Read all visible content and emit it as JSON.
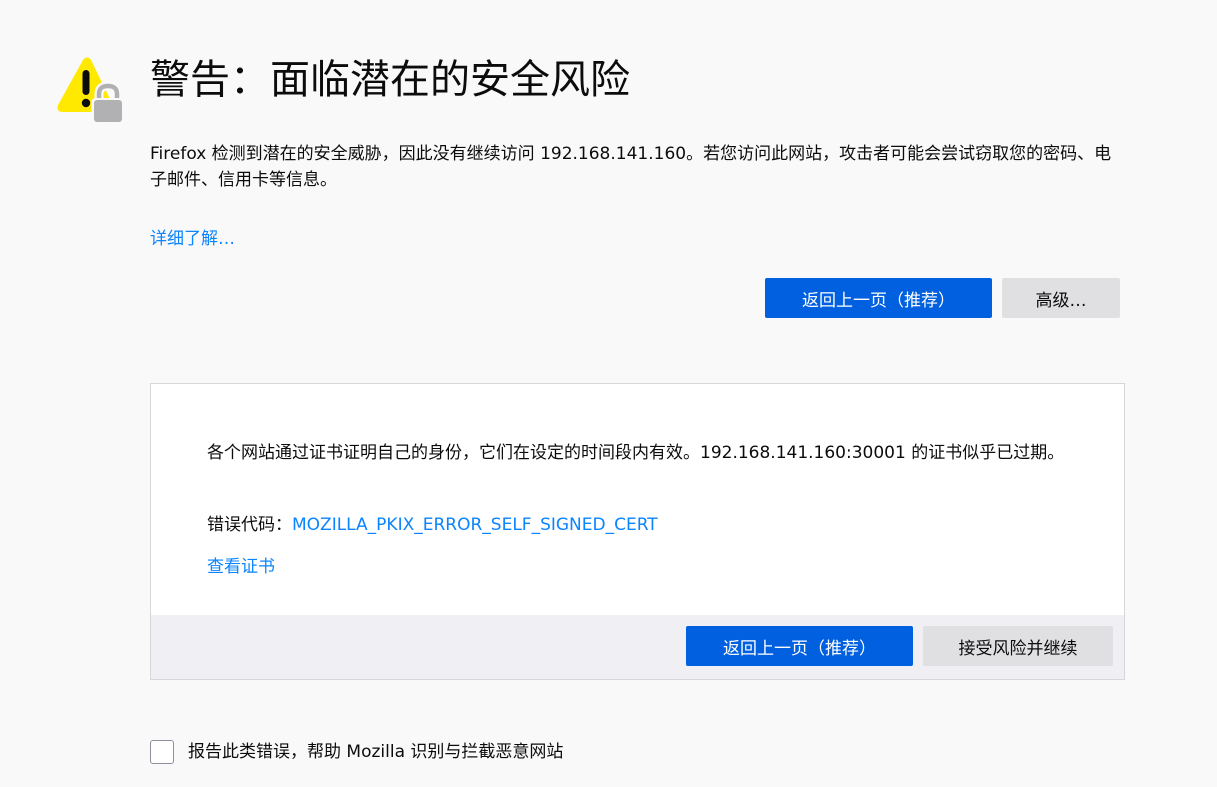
{
  "header": {
    "icon": "warning-lock-icon",
    "title": "警告：面临潜在的安全风险",
    "description": "Firefox 检测到潜在的安全威胁，因此没有继续访问 192.168.141.160。若您访问此网站，攻击者可能会尝试窃取您的密码、电子邮件、信用卡等信息。",
    "learn_more": "详细了解…"
  },
  "actions": {
    "go_back_label": "返回上一页（推荐）",
    "advanced_label": "高级…"
  },
  "advanced_panel": {
    "explanation": "各个网站通过证书证明自己的身份，它们在设定的时间段内有效。192.168.141.160:30001 的证书似乎已过期。",
    "error_code_label": "错误代码：",
    "error_code": "MOZILLA_PKIX_ERROR_SELF_SIGNED_CERT",
    "view_certificate": "查看证书",
    "go_back_label": "返回上一页（推荐）",
    "accept_label": "接受风险并继续"
  },
  "report": {
    "checked": false,
    "label": "报告此类错误，帮助 Mozilla 识别与拦截恶意网站"
  },
  "colors": {
    "background": "#f9f9fa",
    "primary_button": "#0060df",
    "secondary_button": "#e0e0e2",
    "link": "#0a84ff",
    "warning_yellow": "#ffe900",
    "lock_grey": "#b1b1b3"
  }
}
